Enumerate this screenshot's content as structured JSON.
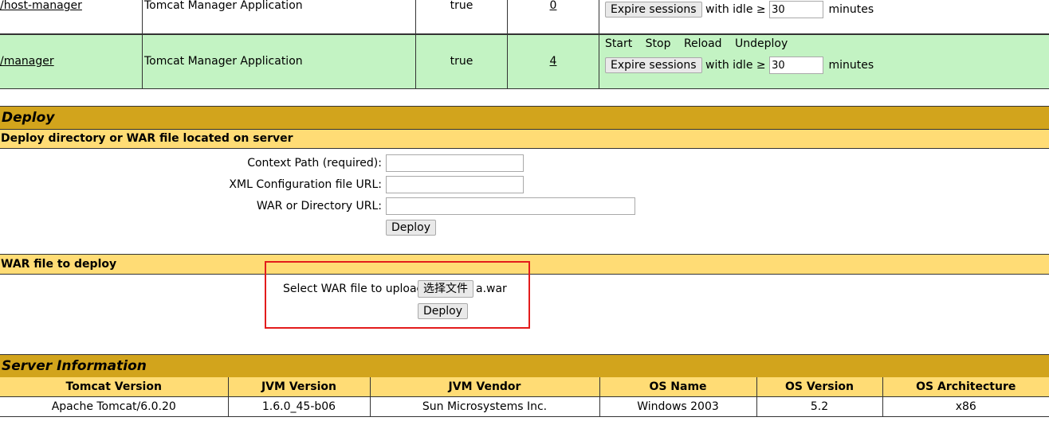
{
  "applications": [
    {
      "path": "/host-manager",
      "display_name": "Tomcat Manager Application",
      "running": "true",
      "sessions": "0",
      "commands": [],
      "expire_label": "Expire sessions",
      "with_idle": "with idle ≥",
      "idle_value": "30",
      "minutes": "minutes"
    },
    {
      "path": "/manager",
      "display_name": "Tomcat Manager Application",
      "running": "true",
      "sessions": "4",
      "commands": [
        "Start",
        "Stop",
        "Reload",
        "Undeploy"
      ],
      "expire_label": "Expire sessions",
      "with_idle": "with idle ≥",
      "idle_value": "30",
      "minutes": "minutes"
    }
  ],
  "deploy": {
    "title": "Deploy",
    "server_section": {
      "title": "Deploy directory or WAR file located on server",
      "context_path_label": "Context Path (required):",
      "context_path_value": "",
      "xml_config_label": "XML Configuration file URL:",
      "xml_config_value": "",
      "war_dir_label": "WAR or Directory URL:",
      "war_dir_value": "",
      "deploy_button": "Deploy"
    },
    "upload_section": {
      "title": "WAR file to deploy",
      "select_label": "Select WAR file to upload",
      "choose_file_button": "选择文件",
      "chosen_file": "a.war",
      "deploy_button": "Deploy"
    }
  },
  "server_info": {
    "title": "Server Information",
    "headers": [
      "Tomcat Version",
      "JVM Version",
      "JVM Vendor",
      "OS Name",
      "OS Version",
      "OS Architecture"
    ],
    "values": [
      "Apache Tomcat/6.0.20",
      "1.6.0_45-b06",
      "Sun Microsystems Inc.",
      "Windows 2003",
      "5.2",
      "x86"
    ]
  },
  "colors": {
    "section_header": "#d2a41c",
    "subsection_header": "#ffdc75",
    "highlight_row": "#c3f3c3",
    "annotation_box": "#e31c1c"
  }
}
